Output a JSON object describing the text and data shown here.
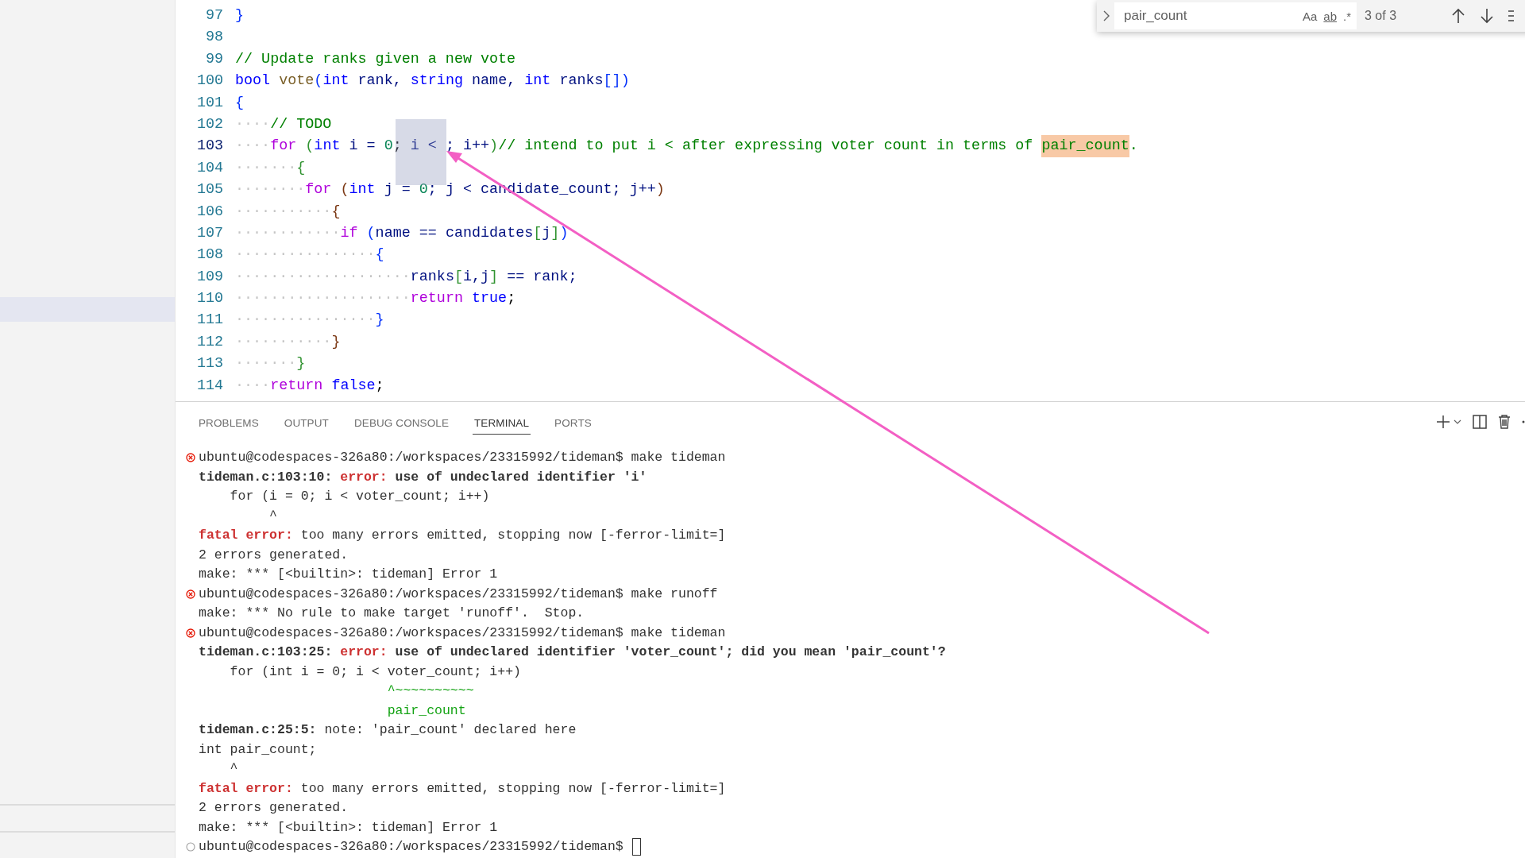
{
  "editor": {
    "lines": [
      {
        "number": "97",
        "active": false,
        "tokens": [
          {
            "kind": "b1",
            "text": "}"
          }
        ]
      },
      {
        "number": "98",
        "active": false
      },
      {
        "number": "99",
        "active": false,
        "tokens": [
          {
            "kind": "comment",
            "text": "// Update ranks given a new vote"
          }
        ]
      },
      {
        "number": "100",
        "active": false,
        "tokens": [
          {
            "kind": "type",
            "text": "bool"
          },
          {
            "kind": "fn",
            "text": " vote"
          },
          {
            "kind": "b1",
            "text": "("
          },
          {
            "kind": "type",
            "text": "int"
          },
          {
            "kind": "var",
            "text": " rank, "
          },
          {
            "kind": "type",
            "text": "string"
          },
          {
            "kind": "var",
            "text": " name, "
          },
          {
            "kind": "type",
            "text": "int"
          },
          {
            "kind": "var",
            "text": " ranks"
          },
          {
            "kind": "b1",
            "text": "[])"
          }
        ]
      },
      {
        "number": "101",
        "active": false,
        "tokens": [
          {
            "kind": "b1",
            "text": "{"
          }
        ]
      },
      {
        "number": "102",
        "active": false,
        "tokens": [
          {
            "kind": "ws",
            "text": "····"
          },
          {
            "kind": "comment",
            "text": "// TODO"
          }
        ]
      },
      {
        "number": "103",
        "active": true,
        "tokens": [
          {
            "kind": "ws",
            "text": "····"
          },
          {
            "kind": "kw",
            "text": "for"
          },
          {
            "kind": "b2",
            "text": " ("
          },
          {
            "kind": "type",
            "text": "int"
          },
          {
            "kind": "var",
            "text": " i = "
          },
          {
            "kind": "num",
            "text": "0"
          },
          {
            "kind": "plain",
            "text": "; "
          },
          {
            "kind": "var",
            "text": "i < ; i++"
          },
          {
            "kind": "b2",
            "text": ")"
          },
          {
            "kind": "comment",
            "text": "// intend to put i < after expressing voter count in terms of "
          },
          {
            "kind": "match",
            "text": "pair_count"
          },
          {
            "kind": "comment",
            "text": "."
          }
        ]
      },
      {
        "number": "104",
        "active": false,
        "tokens": [
          {
            "kind": "ws",
            "text": "·······"
          },
          {
            "kind": "b2",
            "text": "{"
          }
        ]
      },
      {
        "number": "105",
        "active": false,
        "tokens": [
          {
            "kind": "ws",
            "text": "········"
          },
          {
            "kind": "kw",
            "text": "for"
          },
          {
            "kind": "b3",
            "text": " ("
          },
          {
            "kind": "type",
            "text": "int"
          },
          {
            "kind": "var",
            "text": " j = "
          },
          {
            "kind": "num",
            "text": "0"
          },
          {
            "kind": "var",
            "text": "; j < candidate_count; j++"
          },
          {
            "kind": "b3",
            "text": ")"
          }
        ]
      },
      {
        "number": "106",
        "active": false,
        "tokens": [
          {
            "kind": "ws",
            "text": "···········"
          },
          {
            "kind": "b3",
            "text": "{"
          }
        ]
      },
      {
        "number": "107",
        "active": false,
        "tokens": [
          {
            "kind": "ws",
            "text": "············"
          },
          {
            "kind": "kw",
            "text": "if"
          },
          {
            "kind": "b1",
            "text": " ("
          },
          {
            "kind": "var",
            "text": "name == candidates"
          },
          {
            "kind": "b2",
            "text": "["
          },
          {
            "kind": "var",
            "text": "j"
          },
          {
            "kind": "b2",
            "text": "]"
          },
          {
            "kind": "b1",
            "text": ")"
          }
        ]
      },
      {
        "number": "108",
        "active": false,
        "tokens": [
          {
            "kind": "ws",
            "text": "················"
          },
          {
            "kind": "b1",
            "text": "{"
          }
        ]
      },
      {
        "number": "109",
        "active": false,
        "tokens": [
          {
            "kind": "ws",
            "text": "····················"
          },
          {
            "kind": "var",
            "text": "ranks"
          },
          {
            "kind": "b2",
            "text": "["
          },
          {
            "kind": "var",
            "text": "i,j"
          },
          {
            "kind": "b2",
            "text": "]"
          },
          {
            "kind": "var",
            "text": " == rank;"
          }
        ]
      },
      {
        "number": "110",
        "active": false,
        "tokens": [
          {
            "kind": "ws",
            "text": "····················"
          },
          {
            "kind": "kw",
            "text": "return"
          },
          {
            "kind": "type",
            "text": " true"
          },
          {
            "kind": "plain",
            "text": ";"
          }
        ]
      },
      {
        "number": "111",
        "active": false,
        "tokens": [
          {
            "kind": "ws",
            "text": "················"
          },
          {
            "kind": "b1",
            "text": "}"
          }
        ]
      },
      {
        "number": "112",
        "active": false,
        "tokens": [
          {
            "kind": "ws",
            "text": "···········"
          },
          {
            "kind": "b3",
            "text": "}"
          }
        ]
      },
      {
        "number": "113",
        "active": false,
        "tokens": [
          {
            "kind": "ws",
            "text": "·······"
          },
          {
            "kind": "b2",
            "text": "}"
          }
        ]
      },
      {
        "number": "114",
        "active": false,
        "tokens": [
          {
            "kind": "ws",
            "text": "····"
          },
          {
            "kind": "kw",
            "text": "return"
          },
          {
            "kind": "type",
            "text": " false"
          },
          {
            "kind": "plain",
            "text": ";"
          }
        ]
      }
    ]
  },
  "find_widget": {
    "query": "pair_count",
    "options": [
      "Aa",
      "ab",
      ".*"
    ],
    "match_count": "3 of 3"
  },
  "panel": {
    "tabs": [
      {
        "label": "PROBLEMS",
        "selected": false
      },
      {
        "label": "OUTPUT",
        "selected": false
      },
      {
        "label": "DEBUG CONSOLE",
        "selected": false
      },
      {
        "label": "TERMINAL",
        "selected": true
      },
      {
        "label": "PORTS",
        "selected": false
      }
    ],
    "terminal": {
      "cursor": true,
      "lines": [
        {
          "kind": "failed",
          "segments": [
            {
              "kind": "plain",
              "text": "ubuntu@codespaces-326a80:/workspaces/23315992/tideman$ make tideman"
            }
          ]
        },
        {
          "kind": "output",
          "segments": [
            {
              "kind": "bold",
              "text": "tideman.c:103:10: "
            },
            {
              "kind": "error",
              "text": "error:"
            },
            {
              "kind": "bold",
              "text": " use of undeclared identifier 'i'"
            }
          ]
        },
        {
          "kind": "output",
          "segments": [
            {
              "kind": "plain",
              "text": "    for (i = 0; i < voter_count; i++)"
            }
          ]
        },
        {
          "kind": "output",
          "segments": [
            {
              "kind": "plain",
              "text": "         ^"
            }
          ]
        },
        {
          "kind": "output",
          "segments": [
            {
              "kind": "error",
              "text": "fatal error:"
            },
            {
              "kind": "plain",
              "text": " too many errors emitted, stopping now [-ferror-limit=]"
            }
          ]
        },
        {
          "kind": "output",
          "segments": [
            {
              "kind": "plain",
              "text": "2 errors generated."
            }
          ]
        },
        {
          "kind": "output",
          "segments": [
            {
              "kind": "plain",
              "text": "make: *** [<builtin>: tideman] Error 1"
            }
          ]
        },
        {
          "kind": "failed",
          "segments": [
            {
              "kind": "plain",
              "text": "ubuntu@codespaces-326a80:/workspaces/23315992/tideman$ make runoff"
            }
          ]
        },
        {
          "kind": "output",
          "segments": [
            {
              "kind": "plain",
              "text": "make: *** No rule to make target 'runoff'.  Stop."
            }
          ]
        },
        {
          "kind": "failed",
          "segments": [
            {
              "kind": "plain",
              "text": "ubuntu@codespaces-326a80:/workspaces/23315992/tideman$ make tideman"
            }
          ]
        },
        {
          "kind": "output",
          "segments": [
            {
              "kind": "bold",
              "text": "tideman.c:103:25: "
            },
            {
              "kind": "error",
              "text": "error:"
            },
            {
              "kind": "bold",
              "text": " use of undeclared identifier 'voter_count'; did you mean 'pair_count'?"
            }
          ]
        },
        {
          "kind": "output",
          "segments": [
            {
              "kind": "plain",
              "text": "    for (int i = 0; i < voter_count; i++)"
            }
          ]
        },
        {
          "kind": "output",
          "segments": [
            {
              "kind": "hint",
              "text": "                        ^~~~~~~~~~~"
            }
          ]
        },
        {
          "kind": "output",
          "segments": [
            {
              "kind": "hint",
              "text": "                        pair_count"
            }
          ]
        },
        {
          "kind": "output",
          "segments": [
            {
              "kind": "bold",
              "text": "tideman.c:25:5:"
            },
            {
              "kind": "plain",
              "text": " note: 'pair_count' declared here"
            }
          ]
        },
        {
          "kind": "output",
          "segments": [
            {
              "kind": "plain",
              "text": "int pair_count;"
            }
          ]
        },
        {
          "kind": "output",
          "segments": [
            {
              "kind": "plain",
              "text": "    ^"
            }
          ]
        },
        {
          "kind": "output",
          "segments": [
            {
              "kind": "error",
              "text": "fatal error:"
            },
            {
              "kind": "plain",
              "text": " too many errors emitted, stopping now [-ferror-limit=]"
            }
          ]
        },
        {
          "kind": "output",
          "segments": [
            {
              "kind": "plain",
              "text": "2 errors generated."
            }
          ]
        },
        {
          "kind": "output",
          "segments": [
            {
              "kind": "plain",
              "text": "make: *** [<builtin>: tideman] Error 1"
            }
          ]
        },
        {
          "kind": "current",
          "segments": [
            {
              "kind": "plain",
              "text": "ubuntu@codespaces-326a80:/workspaces/23315992/tideman$ "
            }
          ]
        }
      ]
    }
  }
}
